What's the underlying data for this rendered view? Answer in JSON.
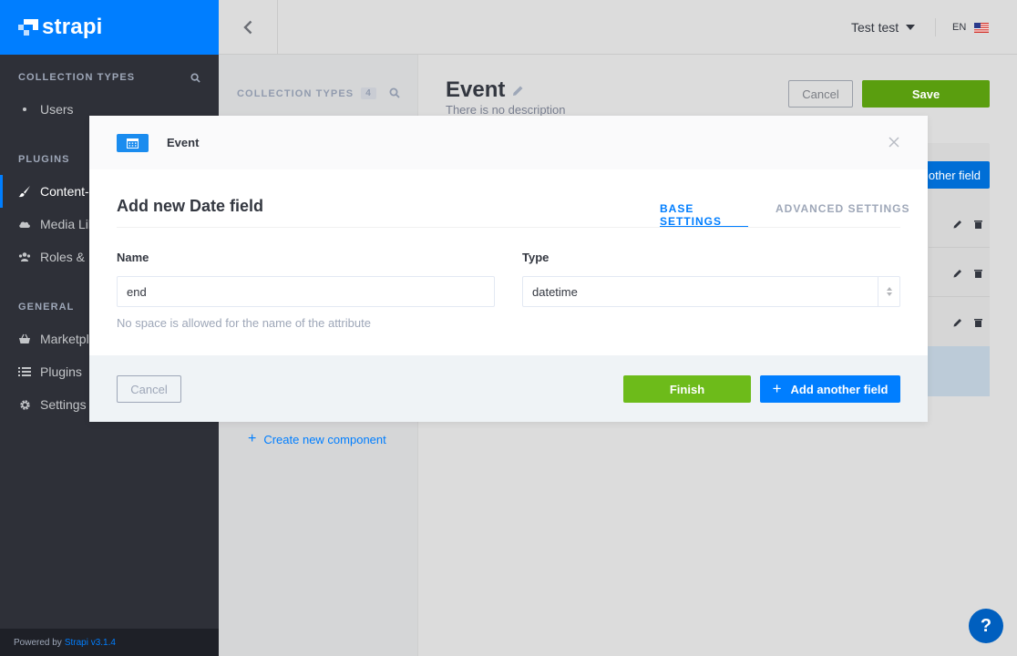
{
  "brand": {
    "name": "strapi",
    "accent": "#007eff"
  },
  "sidebar": {
    "collection_types_heading": "COLLECTION TYPES",
    "collection_items": [
      {
        "label": "Users"
      }
    ],
    "plugins_heading": "PLUGINS",
    "plugin_items": [
      {
        "label": "Content-Types Builder",
        "icon": "paintbrush-icon"
      },
      {
        "label": "Media Library",
        "icon": "cloud-icon"
      },
      {
        "label": "Roles & Permissions",
        "icon": "users-icon"
      }
    ],
    "general_heading": "GENERAL",
    "general_items": [
      {
        "label": "Marketplace",
        "icon": "shopping-basket-icon"
      },
      {
        "label": "Plugins",
        "icon": "list-icon"
      },
      {
        "label": "Settings",
        "icon": "gear-icon"
      }
    ],
    "powered_by": "Powered by",
    "version": "Strapi v3.1.4"
  },
  "header": {
    "user_name": "Test test",
    "language": "EN"
  },
  "builder_panel": {
    "heading": "COLLECTION TYPES",
    "count": "4",
    "create_component": "Create new component"
  },
  "main": {
    "title": "Event",
    "description": "There is no description",
    "cancel": "Cancel",
    "save": "Save",
    "add_field": "Add another field"
  },
  "modal": {
    "content_type": "Event",
    "title": "Add new Date field",
    "tabs": {
      "base": "BASE SETTINGS",
      "advanced": "ADVANCED SETTINGS"
    },
    "name_label": "Name",
    "name_value": "end",
    "type_label": "Type",
    "type_value": "datetime",
    "name_hint": "No space is allowed for the name of the attribute",
    "cancel": "Cancel",
    "finish": "Finish",
    "add_another": "Add another field"
  },
  "help": {
    "label": "?"
  }
}
